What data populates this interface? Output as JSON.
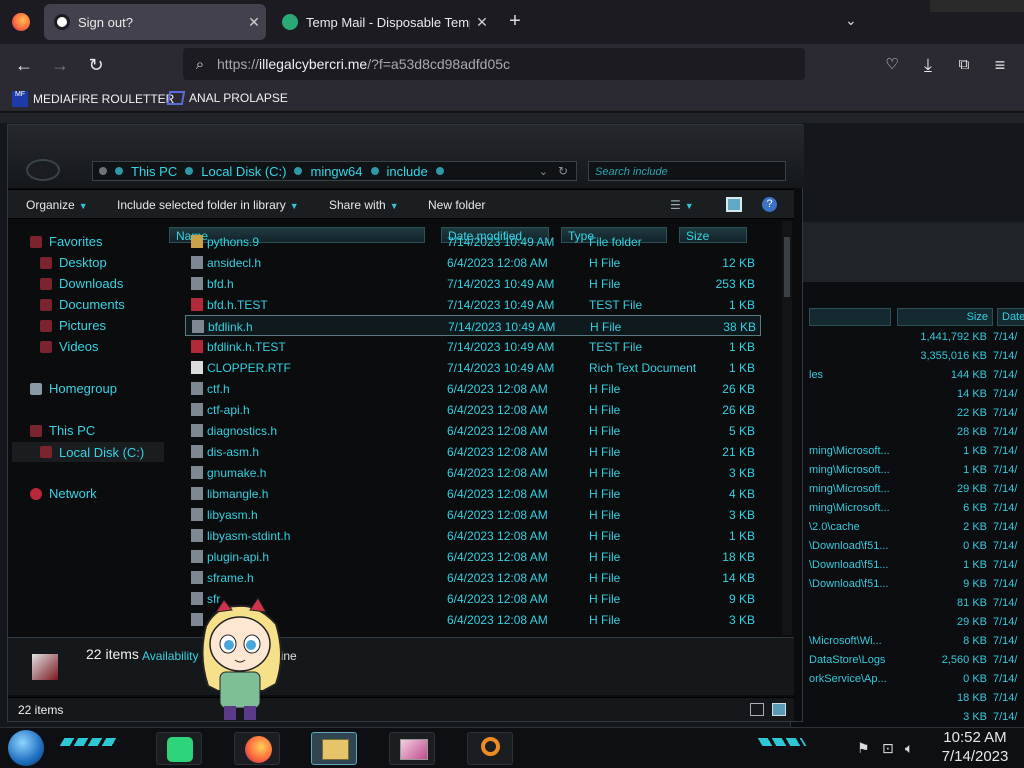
{
  "browser": {
    "tabs": [
      {
        "title": "Sign out?",
        "active": true
      },
      {
        "title": "Temp Mail - Disposable Tempo",
        "active": false
      }
    ],
    "url_prefix": "https://",
    "url_domain": "illegalcybercri.me",
    "url_path": "/?f=a53d8cd98adfd05c",
    "bookmarks": [
      {
        "label": "MEDIAFIRE ROULETTER",
        "icon_text": "MF"
      },
      {
        "label": "ANAL PROLAPSE"
      }
    ]
  },
  "explorer": {
    "breadcrumb": [
      "This PC",
      "Local Disk (C:)",
      "mingw64",
      "include"
    ],
    "search_placeholder": "Search include",
    "toolbar": {
      "organize": "Organize",
      "include": "Include selected folder in library",
      "share": "Share with",
      "new_folder": "New folder"
    },
    "nav": {
      "favorites": "Favorites",
      "desktop": "Desktop",
      "downloads": "Downloads",
      "documents": "Documents",
      "pictures": "Pictures",
      "videos": "Videos",
      "homegroup": "Homegroup",
      "this_pc": "This PC",
      "local_disk": "Local Disk (C:)",
      "network": "Network"
    },
    "columns": {
      "name": "Name",
      "date": "Date modified",
      "type": "Type",
      "size": "Size"
    },
    "files": [
      {
        "name": "pythons.9",
        "date": "7/14/2023 10:49 AM",
        "type": "File folder",
        "size": "",
        "icon": "folder"
      },
      {
        "name": "ansidecl.h",
        "date": "6/4/2023 12:08 AM",
        "type": "H File",
        "size": "12 KB",
        "icon": "h"
      },
      {
        "name": "bfd.h",
        "date": "7/14/2023 10:49 AM",
        "type": "H File",
        "size": "253 KB",
        "icon": "h"
      },
      {
        "name": "bfd.h.TEST",
        "date": "7/14/2023 10:49 AM",
        "type": "TEST File",
        "size": "1 KB",
        "icon": "test"
      },
      {
        "name": "bfdlink.h",
        "date": "7/14/2023 10:49 AM",
        "type": "H File",
        "size": "38 KB",
        "icon": "h"
      },
      {
        "name": "bfdlink.h.TEST",
        "date": "7/14/2023 10:49 AM",
        "type": "TEST File",
        "size": "1 KB",
        "icon": "test"
      },
      {
        "name": "CLOPPER.RTF",
        "date": "7/14/2023 10:49 AM",
        "type": "Rich Text Document",
        "size": "1 KB",
        "icon": "rtf"
      },
      {
        "name": "ctf.h",
        "date": "6/4/2023 12:08 AM",
        "type": "H File",
        "size": "26 KB",
        "icon": "h"
      },
      {
        "name": "ctf-api.h",
        "date": "6/4/2023 12:08 AM",
        "type": "H File",
        "size": "26 KB",
        "icon": "h"
      },
      {
        "name": "diagnostics.h",
        "date": "6/4/2023 12:08 AM",
        "type": "H File",
        "size": "5 KB",
        "icon": "h"
      },
      {
        "name": "dis-asm.h",
        "date": "6/4/2023 12:08 AM",
        "type": "H File",
        "size": "21 KB",
        "icon": "h"
      },
      {
        "name": "gnumake.h",
        "date": "6/4/2023 12:08 AM",
        "type": "H File",
        "size": "3 KB",
        "icon": "h"
      },
      {
        "name": "libmangle.h",
        "date": "6/4/2023 12:08 AM",
        "type": "H File",
        "size": "4 KB",
        "icon": "h"
      },
      {
        "name": "libyasm.h",
        "date": "6/4/2023 12:08 AM",
        "type": "H File",
        "size": "3 KB",
        "icon": "h"
      },
      {
        "name": "libyasm-stdint.h",
        "date": "6/4/2023 12:08 AM",
        "type": "H File",
        "size": "1 KB",
        "icon": "h"
      },
      {
        "name": "plugin-api.h",
        "date": "6/4/2023 12:08 AM",
        "type": "H File",
        "size": "18 KB",
        "icon": "h"
      },
      {
        "name": "sframe.h",
        "date": "6/4/2023 12:08 AM",
        "type": "H File",
        "size": "14 KB",
        "icon": "h"
      },
      {
        "name": "sfr",
        "date": "6/4/2023 12:08 AM",
        "type": "H File",
        "size": "9 KB",
        "icon": "h"
      },
      {
        "name": "",
        "date": "6/4/2023 12:08 AM",
        "type": "H File",
        "size": "3 KB",
        "icon": "h"
      }
    ],
    "selected_index": 4,
    "details": {
      "count": "22 items",
      "availability": "Availability",
      "availability_value": "line"
    },
    "status": "22 items"
  },
  "background_window": {
    "columns": {
      "size": "Size",
      "date": "Date"
    },
    "rows": [
      {
        "name": "",
        "size": "1,441,792 KB",
        "date": "7/14/"
      },
      {
        "name": "",
        "size": "3,355,016 KB",
        "date": "7/14/"
      },
      {
        "name": "les",
        "size": "144 KB",
        "date": "7/14/"
      },
      {
        "name": "",
        "size": "14 KB",
        "date": "7/14/"
      },
      {
        "name": "",
        "size": "22 KB",
        "date": "7/14/"
      },
      {
        "name": "",
        "size": "28 KB",
        "date": "7/14/"
      },
      {
        "name": "ming\\Microsoft...",
        "size": "1 KB",
        "date": "7/14/"
      },
      {
        "name": "ming\\Microsoft...",
        "size": "1 KB",
        "date": "7/14/"
      },
      {
        "name": "ming\\Microsoft...",
        "size": "29 KB",
        "date": "7/14/"
      },
      {
        "name": "ming\\Microsoft...",
        "size": "6 KB",
        "date": "7/14/"
      },
      {
        "name": "\\2.0\\cache",
        "size": "2 KB",
        "date": "7/14/"
      },
      {
        "name": "\\Download\\f51...",
        "size": "0 KB",
        "date": "7/14/"
      },
      {
        "name": "\\Download\\f51...",
        "size": "1 KB",
        "date": "7/14/"
      },
      {
        "name": "\\Download\\f51...",
        "size": "9 KB",
        "date": "7/14/"
      },
      {
        "name": "",
        "size": "81 KB",
        "date": "7/14/"
      },
      {
        "name": "",
        "size": "29 KB",
        "date": "7/14/"
      },
      {
        "name": "\\Microsoft\\Wi...",
        "size": "8 KB",
        "date": "7/14/"
      },
      {
        "name": "DataStore\\Logs",
        "size": "2,560 KB",
        "date": "7/14/"
      },
      {
        "name": "orkService\\Ap...",
        "size": "0 KB",
        "date": "7/14/"
      },
      {
        "name": "",
        "size": "18 KB",
        "date": "7/14/"
      },
      {
        "name": "",
        "size": "3 KB",
        "date": "7/14/"
      }
    ]
  },
  "taskbar": {
    "time": "10:52 AM",
    "date": "7/14/2023"
  }
}
